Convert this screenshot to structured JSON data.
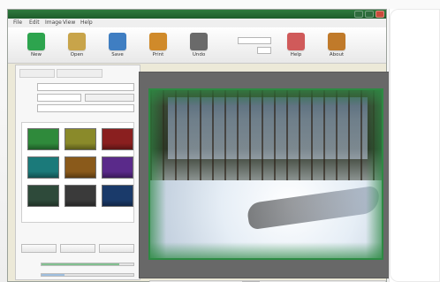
{
  "window": {
    "title": ""
  },
  "menubar": {
    "items": [
      "File",
      "Edit",
      "Image",
      "View",
      "Help"
    ]
  },
  "toolbar": {
    "buttons": [
      {
        "label": "New",
        "icon": "add-icon",
        "color": "#2da44e"
      },
      {
        "label": "Open",
        "icon": "wand-icon",
        "color": "#c8a44a"
      },
      {
        "label": "Save",
        "icon": "image-icon",
        "color": "#3f7ec2"
      },
      {
        "label": "Print",
        "icon": "print-icon",
        "color": "#d08a2a"
      },
      {
        "label": "Undo",
        "icon": "undo-icon",
        "color": "#6a6a6a"
      }
    ],
    "spin_labels": [
      "",
      ""
    ],
    "right_buttons": [
      {
        "label": "Help",
        "icon": "help-icon",
        "color": "#d05a5a"
      },
      {
        "label": "About",
        "icon": "about-icon",
        "color": "#c07a2a"
      }
    ]
  },
  "left_panel": {
    "tabs": [
      "",
      ""
    ],
    "fields": [
      {
        "label": "",
        "value": ""
      },
      {
        "label": "",
        "value": ""
      },
      {
        "label": "",
        "value": ""
      }
    ],
    "thumb_colors": [
      "#2f8a3b",
      "#8a8a2a",
      "#8a1f1f",
      "#1b7a7a",
      "#8a5a1b",
      "#5a2a8a",
      "#2e4a3a",
      "#3a3a3a",
      "#1a3a6a"
    ],
    "bottom_buttons": [
      "",
      "",
      ""
    ],
    "sliders": [
      {
        "label": "",
        "value": 0.85
      },
      {
        "label": "",
        "value": 0.25
      }
    ]
  },
  "canvas": {
    "title": ""
  },
  "status": {
    "scroll_label": ""
  }
}
